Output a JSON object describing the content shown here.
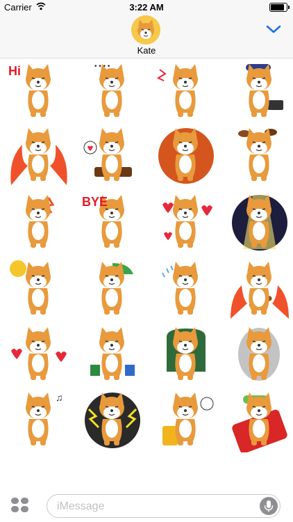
{
  "status_bar": {
    "carrier": "Carrier",
    "time": "3:22 AM",
    "battery_level": 0.85
  },
  "header": {
    "contact_name": "Kate",
    "avatar_icon": "shiba-avatar-icon",
    "collapse_icon": "chevron-down-icon"
  },
  "colors": {
    "accent": "#1a6fe0",
    "shiba": "#e89a3c",
    "fire": "#f0512a",
    "avatar_bg": "#f6c94a"
  },
  "stickers": [
    {
      "name": "sticker-hi",
      "caption": "Hi"
    },
    {
      "name": "sticker-sigh",
      "caption": ""
    },
    {
      "name": "sticker-angry",
      "caption": ""
    },
    {
      "name": "sticker-music-cap",
      "caption": ""
    },
    {
      "name": "sticker-fire-rage",
      "caption": ""
    },
    {
      "name": "sticker-love-food",
      "caption": ""
    },
    {
      "name": "sticker-crying-sunset",
      "caption": ""
    },
    {
      "name": "sticker-food-dream",
      "caption": ""
    },
    {
      "name": "sticker-shocked",
      "caption": ""
    },
    {
      "name": "sticker-bye",
      "caption": "BYE"
    },
    {
      "name": "sticker-hearts",
      "caption": ""
    },
    {
      "name": "sticker-spotlight",
      "caption": ""
    },
    {
      "name": "sticker-sunglasses",
      "caption": ""
    },
    {
      "name": "sticker-umbrella",
      "caption": ""
    },
    {
      "name": "sticker-sweat",
      "caption": ""
    },
    {
      "name": "sticker-guitar-fire",
      "caption": ""
    },
    {
      "name": "sticker-love-blush",
      "caption": ""
    },
    {
      "name": "sticker-shopping",
      "caption": ""
    },
    {
      "name": "sticker-boss-chair",
      "caption": ""
    },
    {
      "name": "sticker-stone",
      "caption": ""
    },
    {
      "name": "sticker-whistle",
      "caption": ""
    },
    {
      "name": "sticker-lightning",
      "caption": ""
    },
    {
      "name": "sticker-beer",
      "caption": ""
    },
    {
      "name": "sticker-sleeping",
      "caption": ""
    }
  ],
  "input_bar": {
    "placeholder": "iMessage",
    "apps_icon": "app-drawer-icon",
    "mic_icon": "microphone-icon"
  }
}
